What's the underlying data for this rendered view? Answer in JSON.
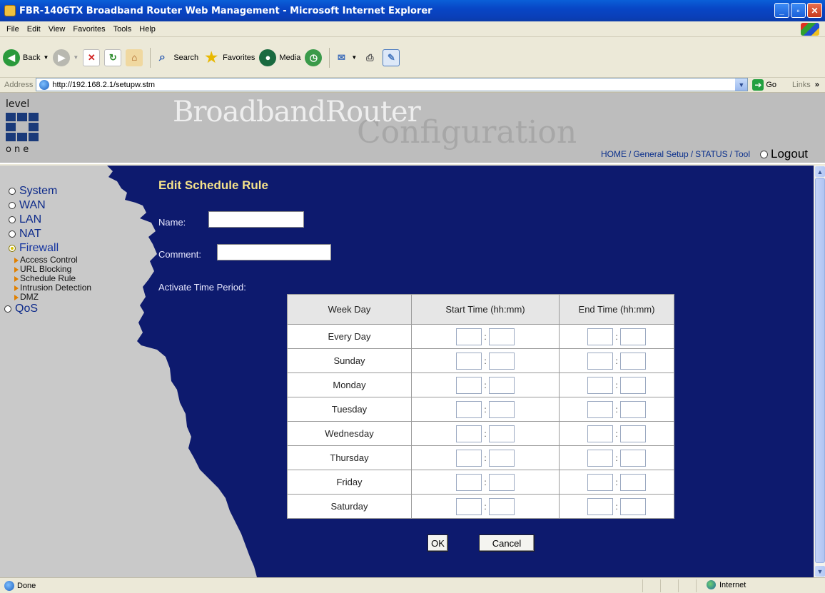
{
  "window": {
    "title": "FBR-1406TX Broadband Router Web Management - Microsoft Internet Explorer",
    "min": "_",
    "max": "▫",
    "close": "✕"
  },
  "menu": [
    "File",
    "Edit",
    "View",
    "Favorites",
    "Tools",
    "Help"
  ],
  "toolbar": {
    "back": "Back",
    "search": "Search",
    "favorites": "Favorites",
    "media": "Media"
  },
  "address": {
    "label": "Address",
    "url": "http://192.168.2.1/setupw.stm",
    "go": "Go",
    "links": "Links"
  },
  "header": {
    "logo_top": "level",
    "logo_bottom": "one",
    "title": "BroadbandRouter",
    "subtitle": "Configuration",
    "links": [
      "HOME",
      "General Setup",
      "STATUS",
      "Tool"
    ],
    "logout": "Logout"
  },
  "sidebar": {
    "items": [
      {
        "label": "System"
      },
      {
        "label": "WAN"
      },
      {
        "label": "LAN"
      },
      {
        "label": "NAT"
      },
      {
        "label": "Firewall"
      },
      {
        "label": "QoS"
      }
    ],
    "firewall_sub": [
      "Access Control",
      "URL Blocking",
      "Schedule Rule",
      "Intrusion Detection",
      "DMZ"
    ]
  },
  "form": {
    "title": "Edit Schedule Rule",
    "name_label": "Name:",
    "comment_label": "Comment:",
    "activate_label": "Activate Time Period:",
    "col_day": "Week Day",
    "col_start": "Start Time (hh:mm)",
    "col_end": "End Time (hh:mm)",
    "days": [
      "Every Day",
      "Sunday",
      "Monday",
      "Tuesday",
      "Wednesday",
      "Thursday",
      "Friday",
      "Saturday"
    ],
    "colon": ":",
    "ok": "OK",
    "cancel": "Cancel"
  },
  "status": {
    "left": "Done",
    "zone": "Internet"
  }
}
